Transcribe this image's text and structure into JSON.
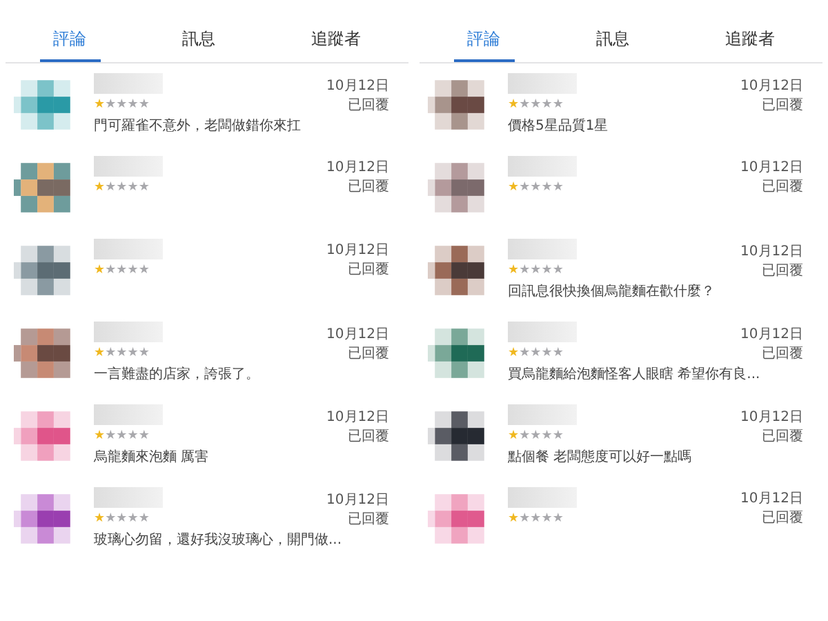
{
  "panels": [
    {
      "tabs": [
        {
          "label": "評論",
          "selected": true
        },
        {
          "label": "訊息",
          "selected": false
        },
        {
          "label": "追蹤者",
          "selected": false
        }
      ],
      "reviews": [
        {
          "stars": 1,
          "text": "門可羅雀不意外，老闆做錯你來扛",
          "date": "10月12日",
          "status": "已回覆"
        },
        {
          "stars": 1,
          "date": "10月12日",
          "status": "已回覆"
        },
        {
          "stars": 1,
          "date": "10月12日",
          "status": "已回覆"
        },
        {
          "stars": 1,
          "text": "一言難盡的店家，誇張了。",
          "date": "10月12日",
          "status": "已回覆"
        },
        {
          "stars": 1,
          "text": "烏龍麵來泡麵 厲害",
          "date": "10月12日",
          "status": "已回覆"
        },
        {
          "stars": 1,
          "text": "玻璃心勿留，還好我沒玻璃心，開門做...",
          "date": "10月12日",
          "status": "已回覆"
        }
      ]
    },
    {
      "tabs": [
        {
          "label": "評論",
          "selected": true
        },
        {
          "label": "訊息",
          "selected": false
        },
        {
          "label": "追蹤者",
          "selected": false
        }
      ],
      "reviews": [
        {
          "stars": 1,
          "text": "價格5星品質1星",
          "date": "10月12日",
          "status": "已回覆"
        },
        {
          "stars": 1,
          "date": "10月12日",
          "status": "已回覆"
        },
        {
          "stars": 1,
          "text": "回訊息很快換個烏龍麵在歡什麼？",
          "date": "10月12日",
          "status": "已回覆"
        },
        {
          "stars": 1,
          "text": "買烏龍麵給泡麵怪客人眼瞎 希望你有良...",
          "date": "10月12日",
          "status": "已回覆"
        },
        {
          "stars": 1,
          "text": "點個餐 老闆態度可以好一點嗎",
          "date": "10月12日",
          "status": "已回覆"
        },
        {
          "stars": 1,
          "date": "10月12日",
          "status": "已回覆"
        }
      ]
    }
  ]
}
